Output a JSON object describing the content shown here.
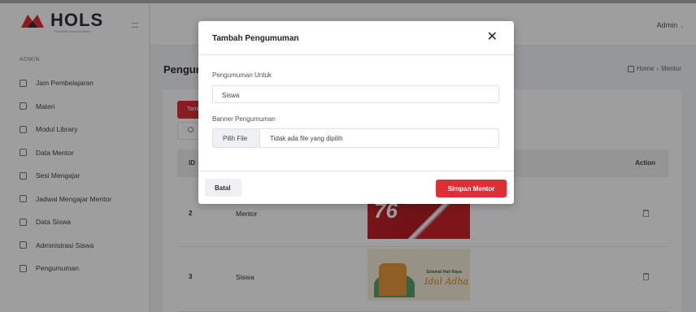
{
  "brand": {
    "name": "HOLS",
    "tagline": "Hospitality learning space",
    "accent": "#dc2f37"
  },
  "sidebar": {
    "section": "ADMIN",
    "items": [
      {
        "label": "Jam Pembelajaran"
      },
      {
        "label": "Materi"
      },
      {
        "label": "Modul Library"
      },
      {
        "label": "Data Mentor"
      },
      {
        "label": "Sesi Mengajar"
      },
      {
        "label": "Jadwal Mengajar Mentor"
      },
      {
        "label": "Data Siswa"
      },
      {
        "label": "Administrasi Siswa"
      },
      {
        "label": "Pengumuman"
      }
    ]
  },
  "header": {
    "user": "Admin",
    "caret": "⌄"
  },
  "page": {
    "title": "Pengumuman",
    "breadcrumb_home": "Home",
    "breadcrumb_sep": "›",
    "breadcrumb_current": "Mentor",
    "add_button": "Tambah"
  },
  "table": {
    "headers": {
      "id": "ID",
      "action": "Action"
    },
    "rows": [
      {
        "id": "2",
        "target": "Mentor",
        "banner_num": "76"
      },
      {
        "id": "3",
        "target": "Siswa",
        "banner_text": "Selamat Hari Raya",
        "banner_script": "Idul Adha"
      }
    ]
  },
  "modal": {
    "title": "Tambah Pengumuman",
    "close": "✕",
    "field_target_label": "Pengumuman Untuk",
    "field_target_value": "Siswa",
    "field_banner_label": "Banner Pengumuman",
    "file_button": "Pilih File",
    "file_status": "Tidak ada file yang dipilih",
    "cancel": "Batal",
    "submit": "Simpan Mentor"
  }
}
